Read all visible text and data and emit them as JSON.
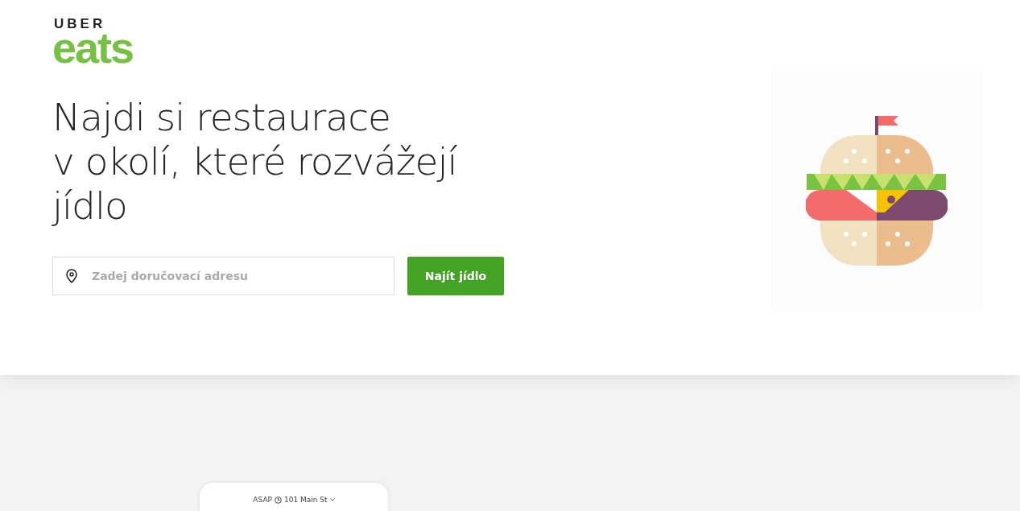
{
  "logo": {
    "top": "UBER",
    "bottom": "eats"
  },
  "headline_lines": [
    "Najdi si restaurace",
    "v okolí, které rozvážejí",
    "jídlo"
  ],
  "search": {
    "placeholder": "Zadej doručovací adresu"
  },
  "button": "Najít jídlo",
  "phone": {
    "time": "ASAP",
    "address": "101 Main St"
  }
}
